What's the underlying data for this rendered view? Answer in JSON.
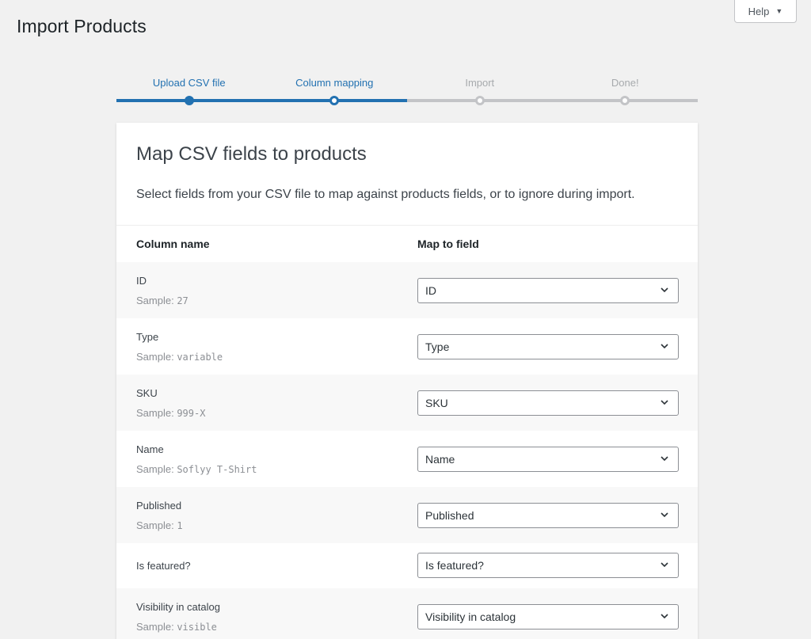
{
  "page": {
    "title": "Import Products",
    "help_label": "Help",
    "help_caret": "▼"
  },
  "steps": [
    {
      "label": "Upload CSV file",
      "state": "done"
    },
    {
      "label": "Column mapping",
      "state": "current"
    },
    {
      "label": "Import",
      "state": "pending"
    },
    {
      "label": "Done!",
      "state": "pending"
    }
  ],
  "card": {
    "title": "Map CSV fields to products",
    "description": "Select fields from your CSV file to map against products fields, or to ignore during import."
  },
  "table": {
    "col_name_header": "Column name",
    "col_map_header": "Map to field",
    "sample_prefix": "Sample:",
    "rows": [
      {
        "name": "ID",
        "sample": "27",
        "mapped": "ID"
      },
      {
        "name": "Type",
        "sample": "variable",
        "mapped": "Type"
      },
      {
        "name": "SKU",
        "sample": "999-X",
        "mapped": "SKU"
      },
      {
        "name": "Name",
        "sample": "Soflyy T-Shirt",
        "mapped": "Name"
      },
      {
        "name": "Published",
        "sample": "1",
        "mapped": "Published"
      },
      {
        "name": "Is featured?",
        "sample": "",
        "mapped": "Is featured?"
      },
      {
        "name": "Visibility in catalog",
        "sample": "visible",
        "mapped": "Visibility in catalog"
      }
    ]
  },
  "colors": {
    "accent": "#2271b1",
    "pending": "#c3c4c7"
  }
}
